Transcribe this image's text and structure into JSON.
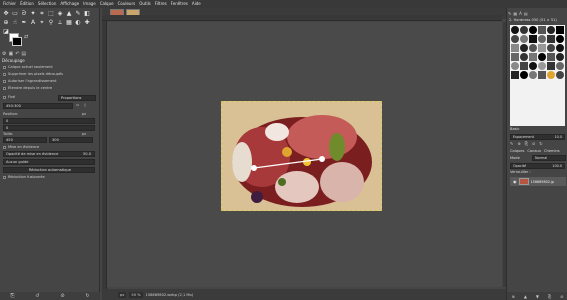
{
  "menu": [
    "Fichier",
    "Édition",
    "Sélection",
    "Affichage",
    "Image",
    "Calque",
    "Couleurs",
    "Outils",
    "Filtres",
    "Fenêtres",
    "Aide"
  ],
  "tool_options": {
    "title": "Découpage",
    "current_layer_only": "Calque actuel seulement",
    "delete_cropped": "Supprimer les pixels découpés",
    "allow_growing": "Autoriser l'agrandissement",
    "expand_from_center": "Étendre depuis le centre",
    "fixed_label": "Fixé",
    "fixed_mode": "Proportions",
    "ratio_value": "450:300",
    "position_label": "Position:",
    "position_unit": "px",
    "position_x": "0",
    "position_y": "0",
    "size_label": "Taille:",
    "size_unit": "px",
    "size_w": "450",
    "size_h": "300",
    "highlight_label": "Mise en évidence",
    "highlight_opacity_label": "Opacité de mise en évidence",
    "highlight_opacity_value": "50.0",
    "guide": "Aucun guide",
    "auto_shrink": "Réduction automatique",
    "shrink_merged": "Réduction fusionnée"
  },
  "status": {
    "unit": "px",
    "zoom": "50 %",
    "filename": "158689802.webp (2,1 Mo)"
  },
  "dock": {
    "brushes_title": "2. Hardness 050 (51 × 51)",
    "brush_tag": "Basic",
    "spacing_label": "Espacement",
    "spacing_value": "10.0",
    "layers_tab": "Calques",
    "channels_tab": "Canaux",
    "paths_tab": "Chemins",
    "mode_label": "Mode",
    "mode_value": "Normal",
    "opacity_label": "Opacité",
    "opacity_value": "100.0",
    "lock_label": "Verrouiller :",
    "layer_name": "158689802.jp"
  },
  "colors": {
    "foreground": "#000000",
    "background": "#ffffff",
    "selection": "#d6c35d"
  }
}
